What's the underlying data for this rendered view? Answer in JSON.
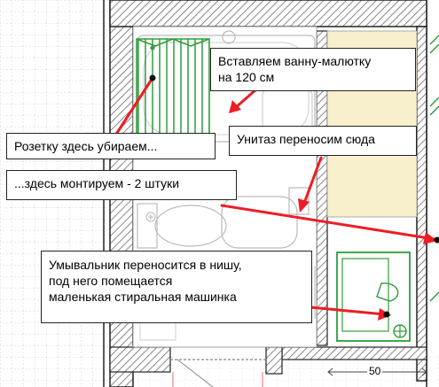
{
  "callouts": {
    "tub": {
      "line1": "Вставляем ванну-малютку",
      "line2": "на 120 см"
    },
    "socket_remove": "Розетку здесь убираем...",
    "toilet_move": "Унитаз переносим сюда",
    "socket_install": "...здесь монтируем - 2 штуки",
    "sink_move": {
      "line1": "Умывальник переносится в нишу,",
      "line2": "под него помещается",
      "line3": "маленькая стиральная машинка"
    }
  },
  "dimension": "50",
  "colors": {
    "arrow": "#ee1c24",
    "fixture": "#2e9e3a",
    "wall_hatch": "#555555",
    "niche_fill": "#f8efcc",
    "grid": "#d9d9d9"
  }
}
